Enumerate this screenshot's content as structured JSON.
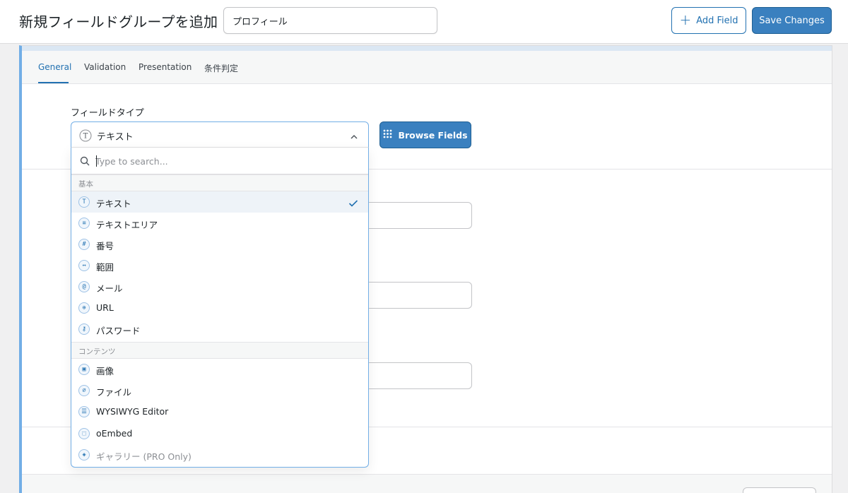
{
  "header": {
    "title": "新規フィールドグループを追加",
    "group_name_value": "プロフィール",
    "add_field_label": "Add Field",
    "save_label": "Save Changes"
  },
  "tabs": [
    {
      "label": "General",
      "active": true
    },
    {
      "label": "Validation",
      "active": false
    },
    {
      "label": "Presentation",
      "active": false
    },
    {
      "label": "条件判定",
      "active": false
    }
  ],
  "field_type": {
    "label": "フィールドタイプ",
    "value": "テキスト",
    "icon": "text-icon",
    "browse_label": "Browse Fields"
  },
  "dropdown": {
    "search_placeholder": "Type to search...",
    "groups": [
      {
        "heading": "基本",
        "items": [
          {
            "label": "テキスト",
            "icon": "text-icon",
            "selected": true
          },
          {
            "label": "テキストエリア",
            "icon": "textarea-icon"
          },
          {
            "label": "番号",
            "icon": "hash-icon"
          },
          {
            "label": "範囲",
            "icon": "range-icon"
          },
          {
            "label": "メール",
            "icon": "at-icon"
          },
          {
            "label": "URL",
            "icon": "globe-icon"
          },
          {
            "label": "パスワード",
            "icon": "key-icon"
          }
        ]
      },
      {
        "heading": "コンテンツ",
        "items": [
          {
            "label": "画像",
            "icon": "image-icon"
          },
          {
            "label": "ファイル",
            "icon": "paperclip-icon"
          },
          {
            "label": "WYSIWYG Editor",
            "icon": "editor-icon"
          },
          {
            "label": "oEmbed",
            "icon": "embed-icon"
          },
          {
            "label": "ギャラリー (PRO Only)",
            "icon": "gallery-icon",
            "disabled": true
          }
        ]
      }
    ]
  },
  "colors": {
    "accent": "#2271b1",
    "primary_button": "#3a80bf",
    "panel_border_left": "#72aee6"
  }
}
